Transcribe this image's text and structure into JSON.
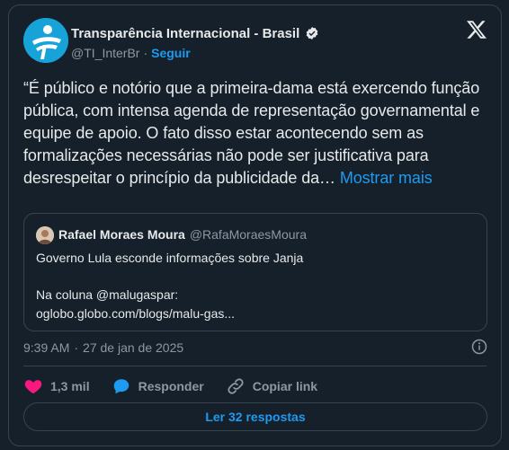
{
  "author": {
    "name": "Transparência Internacional - Brasil",
    "handle": "@TI_InterBr",
    "separator": "·",
    "follow_label": "Seguir"
  },
  "tweet": {
    "text": "“É público e notório que a primeira-dama está exercendo função pública, com intensa agenda de representação governamental e equipe de apoio. O fato disso estar acontecendo sem as formalizações necessárias não pode ser justificativa para desrespeitar o princípio da publicidade da…",
    "show_more": "Mostrar mais"
  },
  "quote": {
    "name": "Rafael Moraes Moura",
    "handle": "@RafaMoraesMoura",
    "line1": "Governo Lula esconde informações sobre Janja",
    "line2": "Na coluna @malugaspar:",
    "line3": "oglobo.globo.com/blogs/malu-gas..."
  },
  "meta": {
    "time": "9:39 AM",
    "separator": "·",
    "date": "27 de jan de 2025"
  },
  "actions": {
    "likes": "1,3 mil",
    "reply": "Responder",
    "copy": "Copiar link"
  },
  "replies_button": "Ler 32 respostas",
  "colors": {
    "background": "#15202b",
    "border": "#38444d",
    "accent": "#1d9bf0",
    "heart": "#f91880",
    "muted": "#8b98a5"
  }
}
